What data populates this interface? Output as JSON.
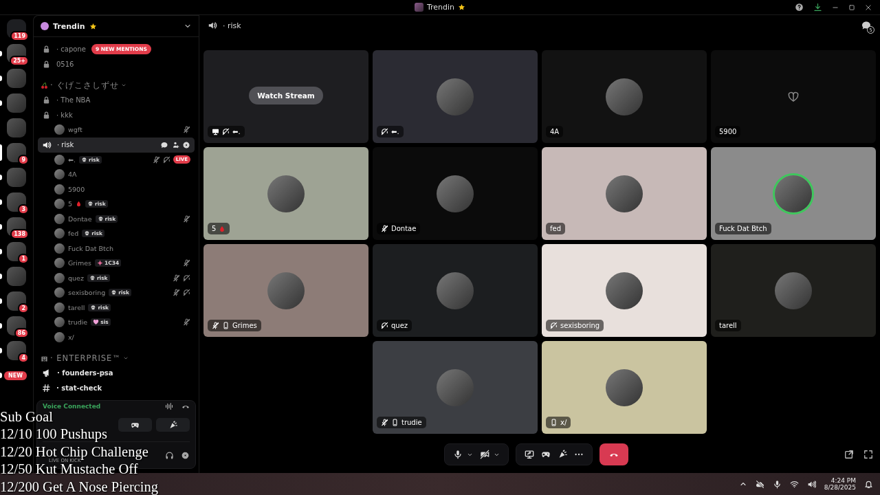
{
  "title_bar": {
    "title": "Trendin"
  },
  "servers": [
    {
      "badge": "119",
      "selected": false,
      "unread": false
    },
    {
      "badge": "25+",
      "selected": false,
      "unread": true
    },
    {
      "selected": false,
      "unread": true
    },
    {
      "selected": false,
      "unread": true
    },
    {
      "selected": false,
      "unread": false
    },
    {
      "badge": "9",
      "selected": true
    },
    {
      "selected": false,
      "unread": true
    },
    {
      "badge": "3",
      "selected": false,
      "unread": true
    },
    {
      "badge": "138",
      "selected": false,
      "unread": true
    },
    {
      "badge": "1",
      "selected": false,
      "unread": true
    },
    {
      "selected": false,
      "unread": true
    },
    {
      "badge": "2",
      "selected": false,
      "unread": true
    },
    {
      "badge": "86",
      "selected": false,
      "unread": true
    },
    {
      "badge": "4",
      "selected": false,
      "unread": true
    },
    {
      "new_badge": "NEW",
      "selected": false,
      "unread": true
    }
  ],
  "sidebar": {
    "server_name": "Trendin",
    "channels": [
      {
        "kind": "locked",
        "name": "· capone",
        "mention_badge": "9 NEW MENTIONS",
        "selected": false
      },
      {
        "kind": "locked",
        "name": "0516",
        "selected": false
      }
    ],
    "categories": [
      {
        "name": "· ぐげこさしずせ",
        "channels": [
          {
            "kind": "locked",
            "name": "· The NBA",
            "selected": false
          },
          {
            "kind": "locked",
            "name": "· kkk",
            "selected": false,
            "members": [
              {
                "name": "wgft",
                "muted": true,
                "deafened": false,
                "live": false
              }
            ]
          },
          {
            "kind": "voice",
            "name": "· risk",
            "selected": true,
            "members": [
              {
                "name": "⬅.",
                "tag": {
                  "kind": "skull",
                  "label": "risk"
                },
                "muted": true,
                "deafened": true,
                "live": true,
                "live_label": "LIVE"
              },
              {
                "name": "4A",
                "muted": false,
                "deafened": false,
                "live": false
              },
              {
                "name": "5900",
                "muted": false,
                "deafened": false,
                "live": false
              },
              {
                "name": "5",
                "drop_emoji": true,
                "tag": {
                  "kind": "skull",
                  "label": "risk"
                },
                "muted": false,
                "deafened": false,
                "live": false
              },
              {
                "name": "Dontae",
                "tag": {
                  "kind": "skull",
                  "label": "risk"
                },
                "muted": true,
                "deafened": false,
                "live": false
              },
              {
                "name": "fed",
                "tag": {
                  "kind": "skull",
                  "label": "risk"
                },
                "muted": false,
                "deafened": false,
                "live": false
              },
              {
                "name": "Fuck Dat Btch",
                "muted": false,
                "deafened": false,
                "live": false
              },
              {
                "name": "Grimes",
                "tag": {
                  "kind": "sparkle",
                  "label": "1C34"
                },
                "muted": true,
                "deafened": false,
                "live": false
              },
              {
                "name": "quez",
                "tag": {
                  "kind": "skull",
                  "label": "risk"
                },
                "muted": true,
                "deafened": true,
                "live": false
              },
              {
                "name": "sexisboring",
                "tag": {
                  "kind": "skull",
                  "label": "risk"
                },
                "muted": true,
                "deafened": true,
                "live": false
              },
              {
                "name": "tarell",
                "tag": {
                  "kind": "skull",
                  "label": "risk"
                },
                "muted": false,
                "deafened": false,
                "live": false
              },
              {
                "name": "trudie",
                "tag": {
                  "kind": "heart",
                  "label": "sis"
                },
                "muted": true,
                "deafened": false,
                "live": false
              },
              {
                "name": "x/",
                "muted": false,
                "deafened": false,
                "live": false
              }
            ]
          }
        ]
      },
      {
        "name": "· ENTERPRISE™",
        "channels": [
          {
            "kind": "announcement",
            "name": "· founders-psa",
            "selected": false
          },
          {
            "kind": "text",
            "name": "· stat-check",
            "selected": false
          }
        ]
      }
    ]
  },
  "voice_panel": {
    "status": "Voice Connected",
    "user_status": "LIVE ON KICK"
  },
  "stream_overlay": {
    "lines": [
      "Sub Goal",
      "12/10 100 Pushups",
      "12/20 Hot Chip Challenge",
      "12/50 Kut Mustache Off",
      "12/200 Get A Nose Piercing"
    ]
  },
  "channel_header": {
    "name": "· risk",
    "notification_count": "5"
  },
  "tiles": [
    {
      "kind": "stream",
      "name": "⬅.",
      "color": "#1e1e21",
      "watch_button": "Watch Stream",
      "screen_share": true,
      "deafened": true,
      "muted": false,
      "mobile": false,
      "speaking": false
    },
    {
      "kind": "avatar",
      "name": "⬅.",
      "color": "#2b2b33",
      "screen_share": false,
      "deafened": true,
      "muted": false,
      "mobile": false,
      "speaking": false
    },
    {
      "kind": "avatar",
      "name": "4A",
      "color": "#121212",
      "screen_share": false,
      "deafened": false,
      "muted": false,
      "mobile": false,
      "speaking": false
    },
    {
      "kind": "emblem",
      "name": "5900",
      "color": "#0c0c0c",
      "screen_share": false,
      "deafened": false,
      "muted": false,
      "mobile": false,
      "speaking": false
    },
    {
      "kind": "avatar",
      "name": "5",
      "drop_emoji": true,
      "color": "#9ea394",
      "screen_share": false,
      "deafened": false,
      "muted": false,
      "mobile": false,
      "speaking": false
    },
    {
      "kind": "avatar",
      "name": "Dontae",
      "color": "#0b0b0b",
      "screen_share": false,
      "deafened": false,
      "muted": true,
      "mobile": false,
      "speaking": false
    },
    {
      "kind": "avatar",
      "name": "fed",
      "color": "#c7b9b7",
      "screen_share": false,
      "deafened": false,
      "muted": false,
      "mobile": false,
      "speaking": false
    },
    {
      "kind": "avatar",
      "name": "Fuck Dat Btch",
      "color": "#8b8b8b",
      "screen_share": false,
      "deafened": false,
      "muted": false,
      "mobile": false,
      "speaking": true
    },
    {
      "kind": "avatar",
      "name": "Grimes",
      "color": "#8d7c77",
      "screen_share": false,
      "deafened": false,
      "muted": true,
      "mobile": true,
      "speaking": false
    },
    {
      "kind": "avatar",
      "name": "quez",
      "color": "#1c1e20",
      "screen_share": false,
      "deafened": true,
      "muted": false,
      "mobile": false,
      "speaking": false
    },
    {
      "kind": "avatar",
      "name": "sexisboring",
      "color": "#e8e0dc",
      "screen_share": false,
      "deafened": true,
      "muted": false,
      "mobile": false,
      "speaking": false
    },
    {
      "kind": "avatar",
      "name": "tarell",
      "color": "#1f1f1c",
      "screen_share": false,
      "deafened": false,
      "muted": false,
      "mobile": false,
      "speaking": false
    },
    {
      "kind": "avatar",
      "name": "trudie",
      "color": "#3c3e43",
      "screen_share": false,
      "deafened": false,
      "muted": true,
      "mobile": true,
      "speaking": false
    },
    {
      "kind": "avatar",
      "name": "x/",
      "color": "#cac4a0",
      "screen_share": false,
      "deafened": false,
      "muted": false,
      "mobile": true,
      "speaking": false
    }
  ],
  "call_controls": {
    "mic_muted": false,
    "camera_off": true
  },
  "taskbar": {
    "time": "4:24 PM",
    "date": "8/28/2025"
  }
}
